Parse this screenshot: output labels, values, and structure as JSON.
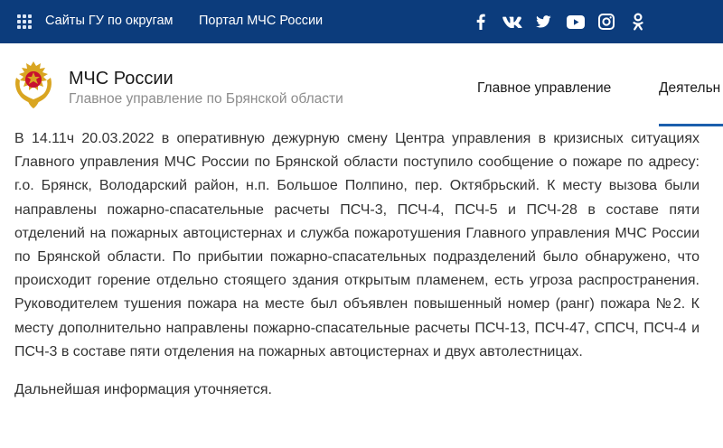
{
  "topbar": {
    "links": [
      "Сайты ГУ по округам",
      "Портал МЧС России"
    ],
    "social_icons": [
      "facebook-icon",
      "vk-icon",
      "twitter-icon",
      "youtube-icon",
      "instagram-icon",
      "odnoklassniki-icon"
    ],
    "background": "#0c3c7c"
  },
  "header": {
    "title": "МЧС России",
    "subtitle": "Главное управление по Брянской области",
    "nav": [
      "Главное управление",
      "Деятельн"
    ]
  },
  "article": {
    "paragraphs": [
      "В 14.11ч 20.03.2022 в оперативную дежурную смену Центра управления в кризисных ситуациях Главного управления МЧС России по Брянской области поступило сообщение о пожаре по адресу: г.о. Брянск, Володарский район, н.п. Большое Полпино, пер. Октябрьский. К месту вызова были направлены пожарно-спасательные расчеты ПСЧ-3, ПСЧ-4, ПСЧ-5 и ПСЧ-28 в составе пяти отделений на пожарных автоцистернах и служба пожаротушения Главного управления МЧС России по Брянской области. По прибытии пожарно-спасательных подразделений было обнаружено, что происходит горение отдельно стоящего здания открытым пламенем, есть угроза распространения. Руководителем тушения пожара на месте был объявлен повышенный номер (ранг) пожара №2. К месту дополнительно направлены пожарно-спасательные расчеты ПСЧ-13, ПСЧ-47, СПСЧ, ПСЧ-4 и ПСЧ-3 в составе пяти отделения на пожарных автоцистернах и двух автолестницах.",
      "Дальнейшая информация уточняется."
    ]
  },
  "colors": {
    "accent": "#1b5fad",
    "emblem_gold": "#d9a521",
    "emblem_red": "#c8102e"
  }
}
